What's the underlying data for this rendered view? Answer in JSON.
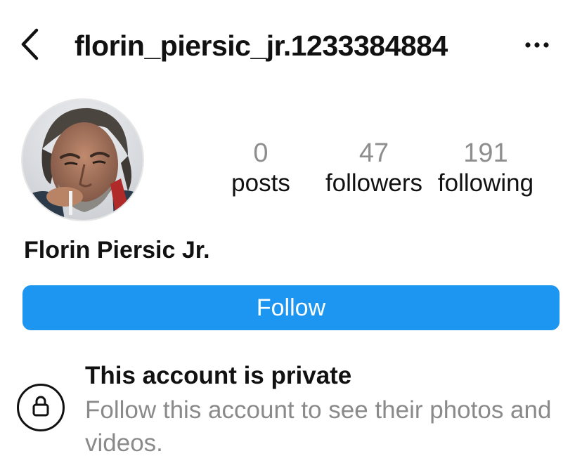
{
  "header": {
    "username": "florin_piersic_jr.1233384884",
    "back_icon": "chevron-left-icon",
    "more_icon": "more-horizontal-icon"
  },
  "profile": {
    "avatar_icon": "profile-photo",
    "display_name": "Florin Piersic Jr.",
    "stats": [
      {
        "value": "0",
        "label": "posts"
      },
      {
        "value": "47",
        "label": "followers"
      },
      {
        "value": "191",
        "label": "following"
      }
    ]
  },
  "actions": {
    "follow_label": "Follow"
  },
  "private_notice": {
    "icon": "lock-icon",
    "title": "This account is private",
    "description": "Follow this account to see their photos and videos."
  },
  "colors": {
    "accent": "#1c96f1",
    "muted_text": "#8a8a8a",
    "text": "#111111"
  }
}
